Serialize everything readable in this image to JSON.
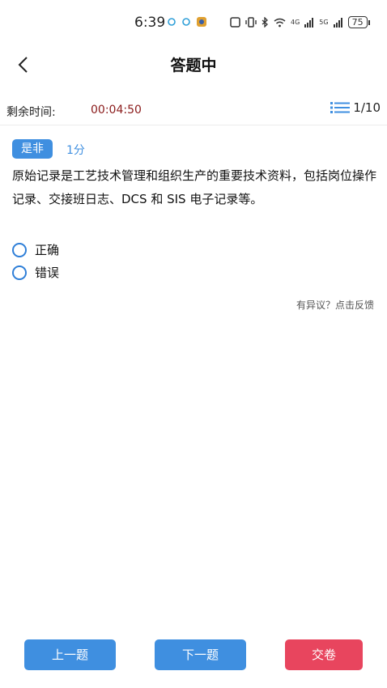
{
  "status_bar": {
    "time": "6:39",
    "battery": "75",
    "network_1": "4G",
    "network_2": "5G"
  },
  "header": {
    "title": "答题中"
  },
  "timer": {
    "label": "剩余时间:",
    "value": "00:04:50"
  },
  "progress": {
    "text": "1/10"
  },
  "question": {
    "type": "是非",
    "score": "1分",
    "text": "原始记录是工艺技术管理和组织生产的重要技术资料，包括岗位操作记录、交接班日志、DCS 和 SIS 电子记录等。",
    "options": [
      {
        "label": "正确"
      },
      {
        "label": "错误"
      }
    ]
  },
  "feedback_link": "有异议？点击反馈",
  "buttons": {
    "prev": "上一题",
    "next": "下一题",
    "submit": "交卷"
  },
  "colors": {
    "accent": "#3f8fe0",
    "submit": "#e8455e",
    "timer": "#8a1a1a"
  }
}
